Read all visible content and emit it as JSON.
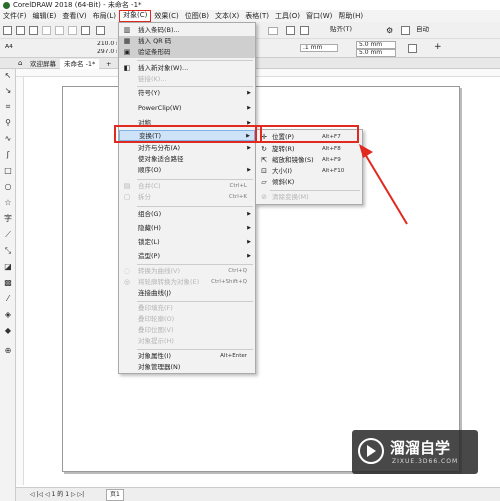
{
  "window": {
    "title": "CorelDRAW 2018 (64-Bit) - 未命名 -1*"
  },
  "menubar": {
    "items": [
      "文件(F)",
      "编辑(E)",
      "查看(V)",
      "布局(L)",
      "对象(C)",
      "效果(C)",
      "位图(B)",
      "文本(X)",
      "表格(T)",
      "工具(O)",
      "窗口(W)",
      "帮助(H)"
    ]
  },
  "toolbar": {
    "page_size": "A4",
    "width": "210.0 mm",
    "height": "297.0 mm",
    "paste_label": "贴齐(T)",
    "auto_label": "自动",
    "nudge": ".1 mm",
    "dup_x": "5.0 mm",
    "dup_y": "5.0 mm",
    "plus": "+"
  },
  "tabs": {
    "welcome": "欢迎屏幕",
    "document": "未命名 -1*",
    "add": "+"
  },
  "status": {
    "page_nav": "◁ |◁ ◁ 1 的 1 ▷ ▷|",
    "page_tab": "页1"
  },
  "object_menu": {
    "items": [
      {
        "label": "插入条码(B)...",
        "icon": "barcode-icon"
      },
      {
        "label": "插入 QR 码",
        "icon": "qr-icon"
      },
      {
        "label": "验证条形码",
        "icon": "verify-icon"
      },
      {
        "label": "插入新对象(W)...",
        "icon": "new-object-icon"
      },
      {
        "label": "链接(K)...",
        "disabled": true
      },
      {
        "label": "符号(Y)",
        "submenu": true
      },
      {
        "label": "PowerClip(W)",
        "submenu": true
      },
      {
        "label": "对称",
        "submenu": true
      },
      {
        "label": "变换(T)",
        "submenu": true
      },
      {
        "label": "对齐与分布(A)",
        "submenu": true
      },
      {
        "label": "使对象适合路径"
      },
      {
        "label": "顺序(O)",
        "submenu": true
      },
      {
        "label": "合并(C)",
        "shortcut": "Ctrl+L",
        "disabled": true
      },
      {
        "label": "拆分",
        "shortcut": "Ctrl+K",
        "disabled": true
      },
      {
        "label": "组合(G)",
        "submenu": true
      },
      {
        "label": "隐藏(H)",
        "submenu": true
      },
      {
        "label": "锁定(L)",
        "submenu": true
      },
      {
        "label": "造型(P)",
        "submenu": true
      },
      {
        "label": "转换为曲线(V)",
        "shortcut": "Ctrl+Q",
        "disabled": true
      },
      {
        "label": "将轮廓转换为对象(E)",
        "shortcut": "Ctrl+Shift+Q",
        "disabled": true
      },
      {
        "label": "连接曲线(J)"
      },
      {
        "label": "叠印填充(F)",
        "disabled": true
      },
      {
        "label": "叠印轮廓(O)",
        "disabled": true
      },
      {
        "label": "叠印位图(V)",
        "disabled": true
      },
      {
        "label": "对象提示(H)",
        "disabled": true
      },
      {
        "label": "对象属性(I)",
        "shortcut": "Alt+Enter"
      },
      {
        "label": "对象管理器(N)"
      }
    ]
  },
  "transform_submenu": {
    "items": [
      {
        "label": "位置(P)",
        "shortcut": "Alt+F7",
        "icon": "position-icon"
      },
      {
        "label": "旋转(R)",
        "shortcut": "Alt+F8",
        "icon": "rotate-icon"
      },
      {
        "label": "缩放和镜像(S)",
        "shortcut": "Alt+F9",
        "icon": "scale-icon"
      },
      {
        "label": "大小(I)",
        "shortcut": "Alt+F10",
        "icon": "size-icon"
      },
      {
        "label": "倾斜(K)",
        "icon": "skew-icon"
      },
      {
        "label": "清除变换(M)",
        "disabled": true
      }
    ]
  },
  "watermark": {
    "name": "溜溜自学",
    "url": "ZIXUE.3D66.COM"
  },
  "colors": {
    "highlight_red": "#e0291f",
    "selection_blue": "#cfe3f8",
    "arrow_red": "#e0291f"
  }
}
